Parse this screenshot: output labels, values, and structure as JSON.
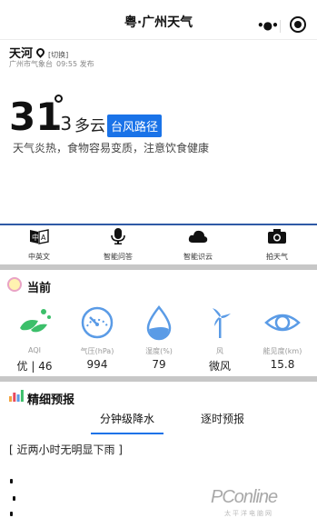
{
  "header": {
    "title": "粤·广州天气"
  },
  "location": {
    "name": "天河",
    "switch_label": "[切换]",
    "publisher": "广州市气象台",
    "publish_time": "09:55 发布"
  },
  "now": {
    "temp_integer": "31",
    "temp_decimal": ".3",
    "condition": "多云",
    "typhoon_button": "台风路径",
    "tip": "天气炎热，食物容易变质，注意饮食健康"
  },
  "tools": [
    {
      "label": "中英文",
      "icon": "translate-icon"
    },
    {
      "label": "智能问答",
      "icon": "microphone-icon"
    },
    {
      "label": "智能识云",
      "icon": "cloud-icon"
    },
    {
      "label": "拍天气",
      "icon": "camera-icon"
    }
  ],
  "current": {
    "title": "当前",
    "items": [
      {
        "label": "AQI",
        "value": "优 | 46",
        "icon": "leaf-icon"
      },
      {
        "label": "气压(hPa)",
        "value": "994",
        "icon": "gauge-icon"
      },
      {
        "label": "湿度(%)",
        "value": "79",
        "icon": "droplet-icon"
      },
      {
        "label": "风",
        "value": "微风",
        "icon": "wind-turbine-icon"
      },
      {
        "label": "能见度(km)",
        "value": "15.8",
        "icon": "eye-icon"
      }
    ]
  },
  "forecast": {
    "title": "精细预报",
    "tabs": [
      "分钟级降水",
      "逐时预报"
    ],
    "active_tab": 0,
    "hint": "[ 近两小时无明显下雨 ]"
  },
  "watermark": {
    "brand": "PConline",
    "sub": "太平洋电脑网"
  },
  "colors": {
    "accent": "#1a73e8",
    "icon_blue": "#5a9be6",
    "leaf_green": "#3cbf6a",
    "divider_blue": "#2f5aa6"
  }
}
